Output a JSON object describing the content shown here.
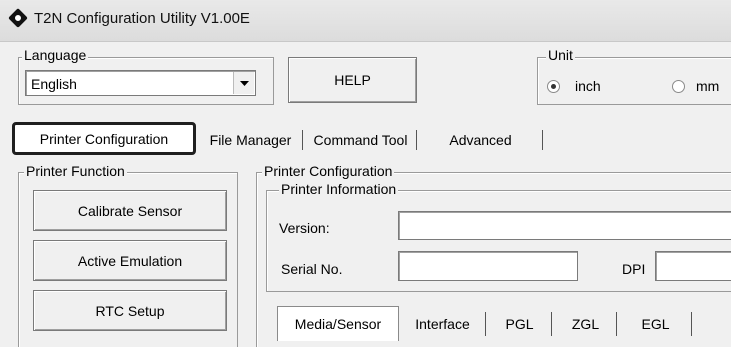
{
  "window": {
    "title": "T2N Configuration Utility V1.00E",
    "icon": "diamond-app-icon"
  },
  "language": {
    "legend": "Language",
    "value": "English"
  },
  "help_button": "HELP",
  "unit": {
    "legend": "Unit",
    "options": [
      {
        "label": "inch",
        "selected": true
      },
      {
        "label": "mm",
        "selected": false
      }
    ]
  },
  "tabs": [
    "Printer Configuration",
    "File Manager",
    "Command Tool",
    "Advanced"
  ],
  "active_tab": "Printer Configuration",
  "printer_function": {
    "legend": "Printer Function",
    "buttons": [
      "Calibrate Sensor",
      "Active Emulation",
      "RTC Setup"
    ]
  },
  "printer_config": {
    "legend": "Printer Configuration",
    "info_legend": "Printer Information",
    "version_label": "Version:",
    "version_value": "",
    "serial_label": "Serial No.",
    "serial_value": "",
    "dpi_label": "DPI",
    "dpi_value": ""
  },
  "sub_tabs": [
    "Media/Sensor",
    "Interface",
    "PGL",
    "ZGL",
    "EGL"
  ],
  "active_sub_tab": "Media/Sensor"
}
